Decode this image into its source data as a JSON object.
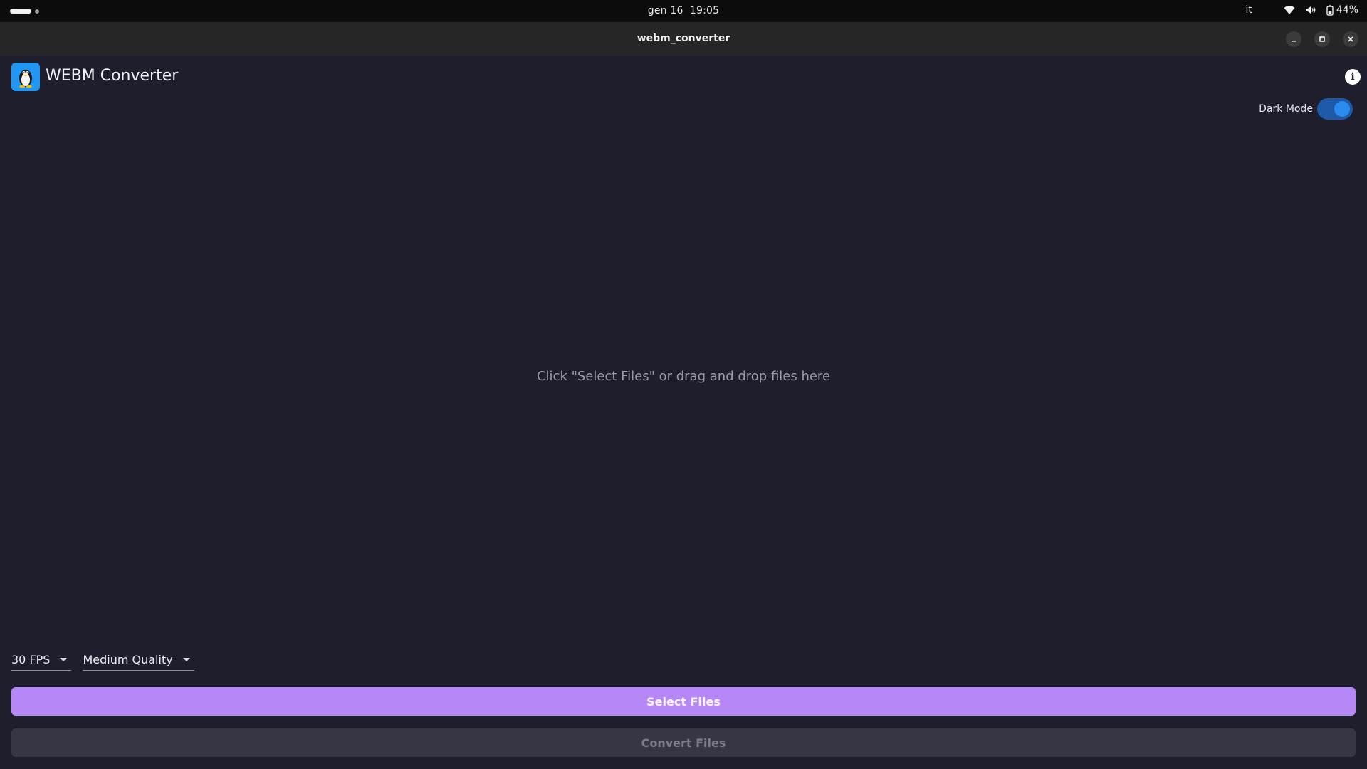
{
  "system_bar": {
    "date": "gen 16",
    "time": "19:05",
    "language": "it",
    "battery": "44%"
  },
  "window": {
    "title": "webm_converter"
  },
  "app": {
    "title": "WEBM Converter",
    "dark_mode_label": "Dark Mode",
    "dark_mode_on": true,
    "dropzone_text": "Click \"Select Files\" or drag and drop files here",
    "fps_select": "30 FPS",
    "quality_select": "Medium Quality",
    "select_files_label": "Select Files",
    "convert_files_label": "Convert Files"
  },
  "colors": {
    "background": "#1e1e2d",
    "accent_purple": "#b688f7",
    "toggle_blue": "#2b8cf0",
    "disabled_button": "#363644"
  }
}
